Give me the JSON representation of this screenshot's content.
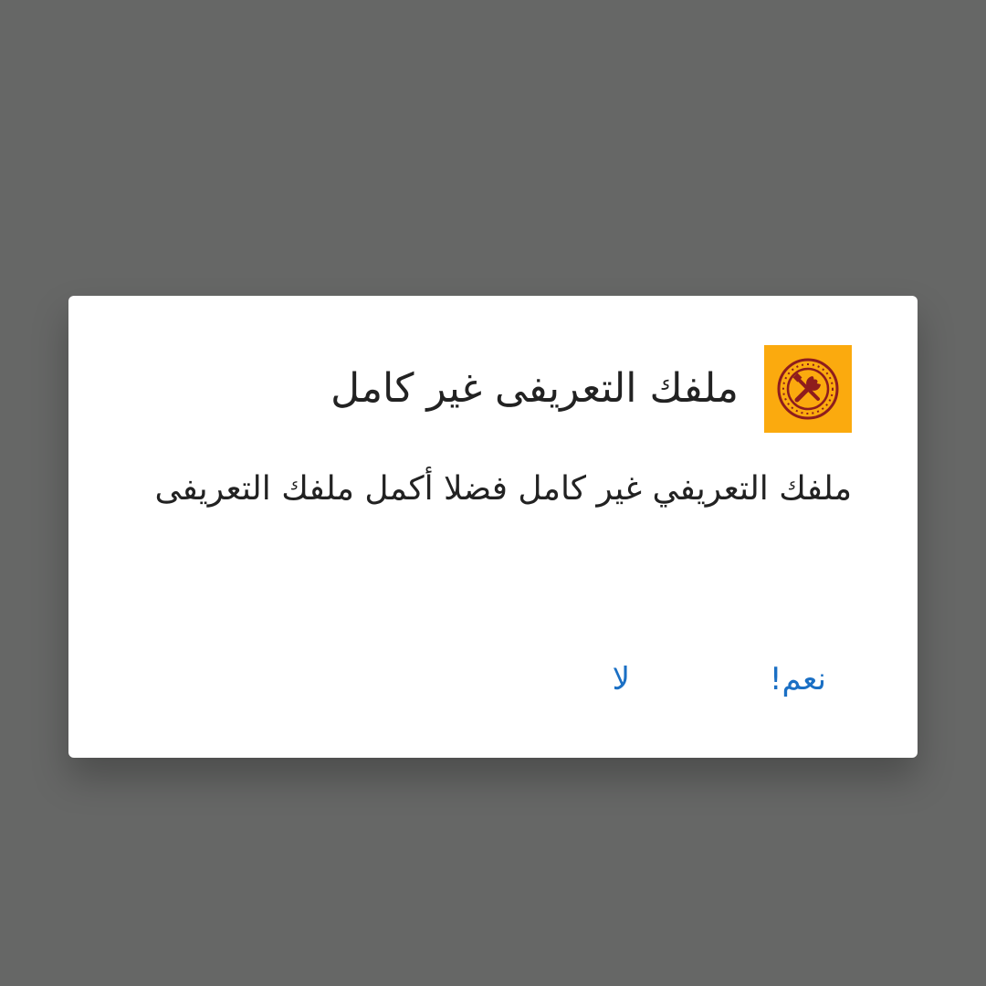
{
  "dialog": {
    "icon": "wrench-screwdriver-gauge-icon",
    "accent_color": "#fbaa0e",
    "title": "ملفك التعريفى غير كامل",
    "message": "ملفك التعريفي غير كامل فضلا أكمل ملفك التعريفى",
    "actions": {
      "yes_label": "نعم!",
      "no_label": "لا"
    },
    "action_color": "#1a6fc4"
  }
}
